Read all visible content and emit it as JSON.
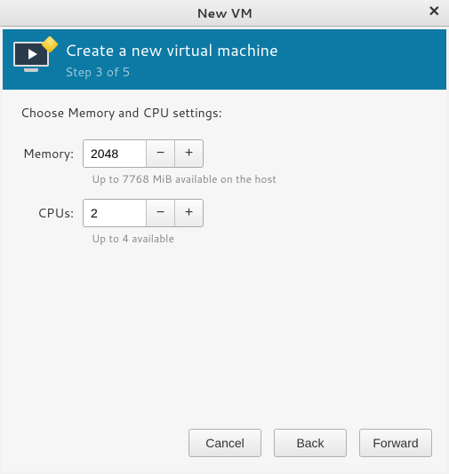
{
  "titlebar": {
    "title": "New VM"
  },
  "header": {
    "title": "Create a new virtual machine",
    "step": "Step 3 of 5"
  },
  "body": {
    "instruction": "Choose Memory and CPU settings:",
    "memory": {
      "label": "Memory:",
      "value": "2048",
      "hint": "Up to 7768 MiB available on the host"
    },
    "cpus": {
      "label": "CPUs:",
      "value": "2",
      "hint": "Up to 4 available"
    }
  },
  "footer": {
    "cancel": "Cancel",
    "back": "Back",
    "forward": "Forward"
  }
}
